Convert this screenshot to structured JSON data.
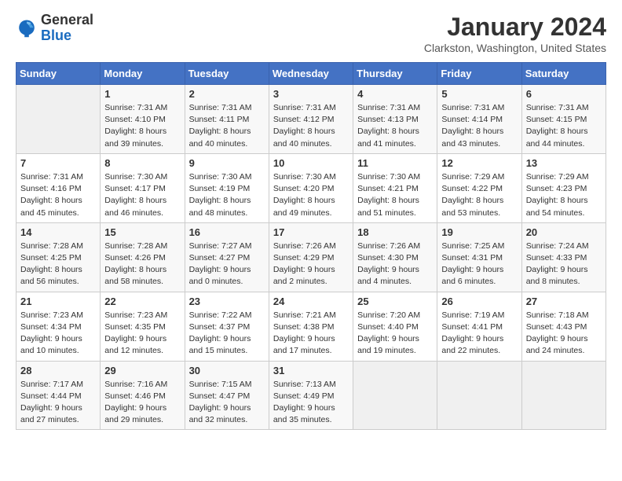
{
  "header": {
    "logo_general": "General",
    "logo_blue": "Blue",
    "month_title": "January 2024",
    "location": "Clarkston, Washington, United States"
  },
  "days_of_week": [
    "Sunday",
    "Monday",
    "Tuesday",
    "Wednesday",
    "Thursday",
    "Friday",
    "Saturday"
  ],
  "weeks": [
    [
      {
        "num": "",
        "sunrise": "",
        "sunset": "",
        "daylight": ""
      },
      {
        "num": "1",
        "sunrise": "7:31 AM",
        "sunset": "4:10 PM",
        "daylight": "8 hours and 39 minutes."
      },
      {
        "num": "2",
        "sunrise": "7:31 AM",
        "sunset": "4:11 PM",
        "daylight": "8 hours and 40 minutes."
      },
      {
        "num": "3",
        "sunrise": "7:31 AM",
        "sunset": "4:12 PM",
        "daylight": "8 hours and 40 minutes."
      },
      {
        "num": "4",
        "sunrise": "7:31 AM",
        "sunset": "4:13 PM",
        "daylight": "8 hours and 41 minutes."
      },
      {
        "num": "5",
        "sunrise": "7:31 AM",
        "sunset": "4:14 PM",
        "daylight": "8 hours and 43 minutes."
      },
      {
        "num": "6",
        "sunrise": "7:31 AM",
        "sunset": "4:15 PM",
        "daylight": "8 hours and 44 minutes."
      }
    ],
    [
      {
        "num": "7",
        "sunrise": "7:31 AM",
        "sunset": "4:16 PM",
        "daylight": "8 hours and 45 minutes."
      },
      {
        "num": "8",
        "sunrise": "7:30 AM",
        "sunset": "4:17 PM",
        "daylight": "8 hours and 46 minutes."
      },
      {
        "num": "9",
        "sunrise": "7:30 AM",
        "sunset": "4:19 PM",
        "daylight": "8 hours and 48 minutes."
      },
      {
        "num": "10",
        "sunrise": "7:30 AM",
        "sunset": "4:20 PM",
        "daylight": "8 hours and 49 minutes."
      },
      {
        "num": "11",
        "sunrise": "7:30 AM",
        "sunset": "4:21 PM",
        "daylight": "8 hours and 51 minutes."
      },
      {
        "num": "12",
        "sunrise": "7:29 AM",
        "sunset": "4:22 PM",
        "daylight": "8 hours and 53 minutes."
      },
      {
        "num": "13",
        "sunrise": "7:29 AM",
        "sunset": "4:23 PM",
        "daylight": "8 hours and 54 minutes."
      }
    ],
    [
      {
        "num": "14",
        "sunrise": "7:28 AM",
        "sunset": "4:25 PM",
        "daylight": "8 hours and 56 minutes."
      },
      {
        "num": "15",
        "sunrise": "7:28 AM",
        "sunset": "4:26 PM",
        "daylight": "8 hours and 58 minutes."
      },
      {
        "num": "16",
        "sunrise": "7:27 AM",
        "sunset": "4:27 PM",
        "daylight": "9 hours and 0 minutes."
      },
      {
        "num": "17",
        "sunrise": "7:26 AM",
        "sunset": "4:29 PM",
        "daylight": "9 hours and 2 minutes."
      },
      {
        "num": "18",
        "sunrise": "7:26 AM",
        "sunset": "4:30 PM",
        "daylight": "9 hours and 4 minutes."
      },
      {
        "num": "19",
        "sunrise": "7:25 AM",
        "sunset": "4:31 PM",
        "daylight": "9 hours and 6 minutes."
      },
      {
        "num": "20",
        "sunrise": "7:24 AM",
        "sunset": "4:33 PM",
        "daylight": "9 hours and 8 minutes."
      }
    ],
    [
      {
        "num": "21",
        "sunrise": "7:23 AM",
        "sunset": "4:34 PM",
        "daylight": "9 hours and 10 minutes."
      },
      {
        "num": "22",
        "sunrise": "7:23 AM",
        "sunset": "4:35 PM",
        "daylight": "9 hours and 12 minutes."
      },
      {
        "num": "23",
        "sunrise": "7:22 AM",
        "sunset": "4:37 PM",
        "daylight": "9 hours and 15 minutes."
      },
      {
        "num": "24",
        "sunrise": "7:21 AM",
        "sunset": "4:38 PM",
        "daylight": "9 hours and 17 minutes."
      },
      {
        "num": "25",
        "sunrise": "7:20 AM",
        "sunset": "4:40 PM",
        "daylight": "9 hours and 19 minutes."
      },
      {
        "num": "26",
        "sunrise": "7:19 AM",
        "sunset": "4:41 PM",
        "daylight": "9 hours and 22 minutes."
      },
      {
        "num": "27",
        "sunrise": "7:18 AM",
        "sunset": "4:43 PM",
        "daylight": "9 hours and 24 minutes."
      }
    ],
    [
      {
        "num": "28",
        "sunrise": "7:17 AM",
        "sunset": "4:44 PM",
        "daylight": "9 hours and 27 minutes."
      },
      {
        "num": "29",
        "sunrise": "7:16 AM",
        "sunset": "4:46 PM",
        "daylight": "9 hours and 29 minutes."
      },
      {
        "num": "30",
        "sunrise": "7:15 AM",
        "sunset": "4:47 PM",
        "daylight": "9 hours and 32 minutes."
      },
      {
        "num": "31",
        "sunrise": "7:13 AM",
        "sunset": "4:49 PM",
        "daylight": "9 hours and 35 minutes."
      },
      {
        "num": "",
        "sunrise": "",
        "sunset": "",
        "daylight": ""
      },
      {
        "num": "",
        "sunrise": "",
        "sunset": "",
        "daylight": ""
      },
      {
        "num": "",
        "sunrise": "",
        "sunset": "",
        "daylight": ""
      }
    ]
  ],
  "labels": {
    "sunrise": "Sunrise:",
    "sunset": "Sunset:",
    "daylight": "Daylight:"
  }
}
